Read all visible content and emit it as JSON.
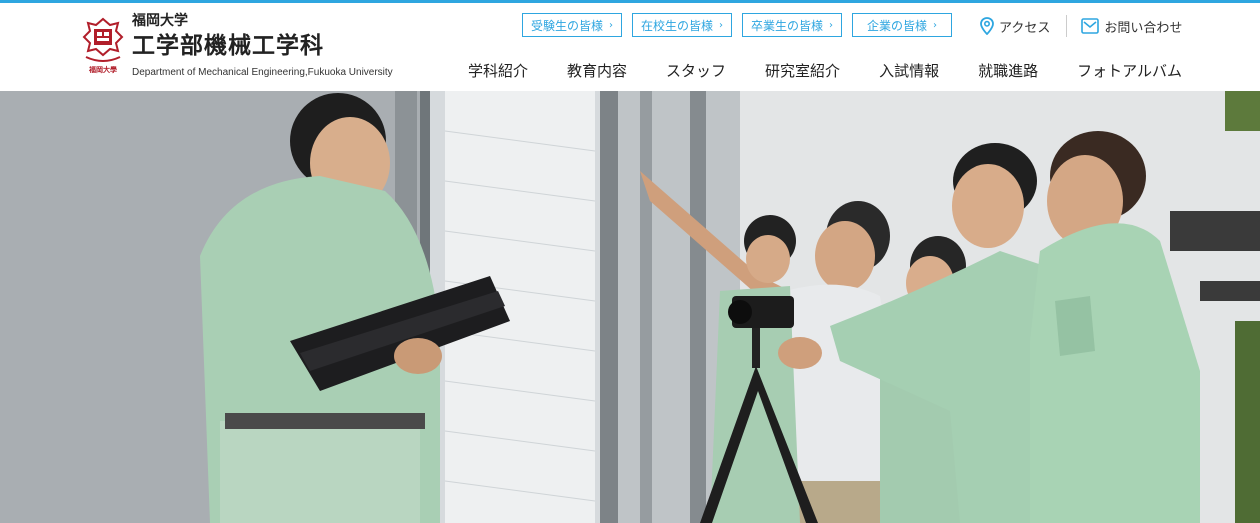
{
  "header": {
    "university": "福岡大学",
    "department": "工学部機械工学科",
    "department_en": "Department of Mechanical Engineering,Fukuoka University",
    "emblem_caption": "福岡大學"
  },
  "audience_links": [
    {
      "label": "受験生の皆様"
    },
    {
      "label": "在校生の皆様"
    },
    {
      "label": "卒業生の皆様"
    },
    {
      "label": "企業の皆様"
    }
  ],
  "utility": {
    "access": "アクセス",
    "contact": "お問い合わせ"
  },
  "nav": [
    {
      "label": "学科紹介"
    },
    {
      "label": "教育内容"
    },
    {
      "label": "スタッフ"
    },
    {
      "label": "研究室紹介"
    },
    {
      "label": "入試情報"
    },
    {
      "label": "就職進路"
    },
    {
      "label": "フォトアルバム"
    }
  ],
  "colors": {
    "accent": "#2ea6e0",
    "emblem": "#b11e2a",
    "uniform": "#a8d3b4"
  },
  "icons": {
    "chevron": "chevron-right-icon",
    "access": "map-pin-icon",
    "contact": "mail-icon"
  }
}
